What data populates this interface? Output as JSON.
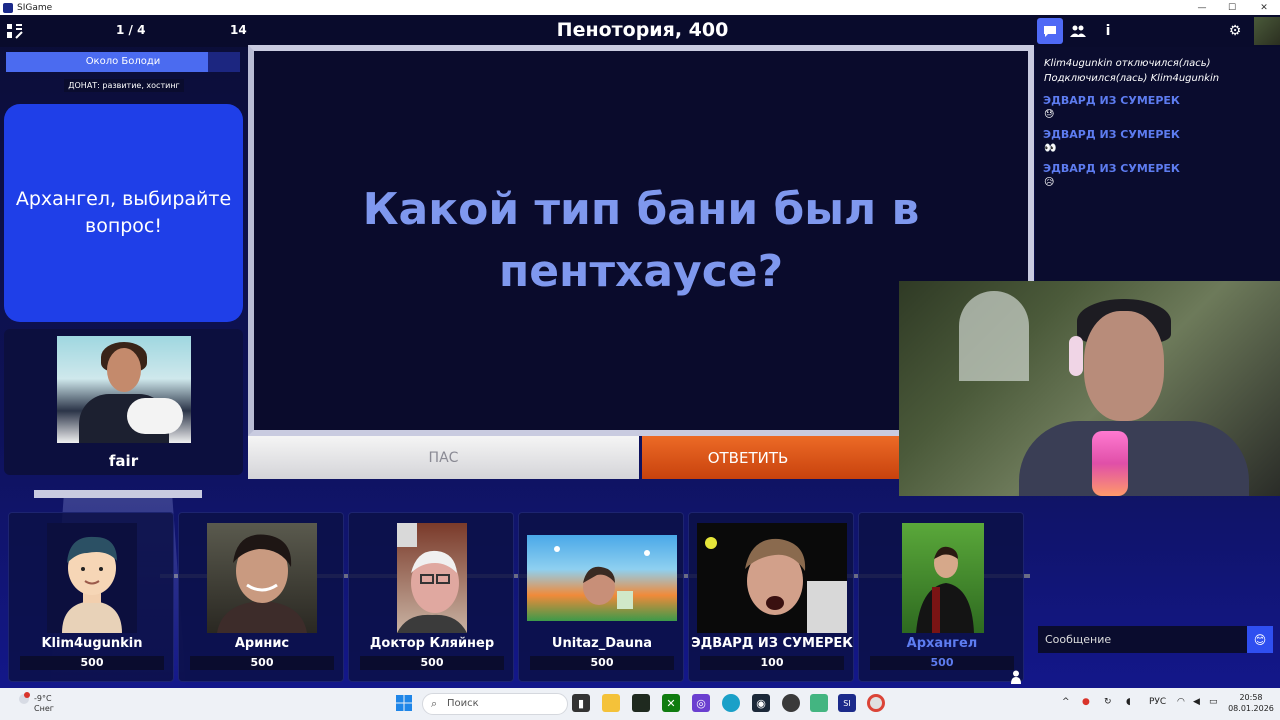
{
  "window": {
    "title": "SIGame",
    "controls": [
      "—",
      "☐",
      "✕"
    ]
  },
  "top": {
    "round": "1 / 4",
    "count": "14",
    "theme": "Пенотория, 400"
  },
  "showman": {
    "name": "Около Болоди",
    "donate": "ДОНАТ: развитие, хостинг",
    "bubble": "Архангел, выбирайте вопрос!",
    "host_name": "fair"
  },
  "question": {
    "text": "Какой тип бани был в пентхаусе?"
  },
  "buttons": {
    "pass": "ПАС",
    "answer": "ОТВЕТИТЬ"
  },
  "chat": {
    "system": [
      "Klim4ugunkin отключился(лась)",
      "Подключился(лась) Klim4ugunkin"
    ],
    "messages": [
      {
        "author": "ЭДВАРД ИЗ СУМЕРЕК",
        "text": "😓"
      },
      {
        "author": "ЭДВАРД ИЗ СУМЕРЕК",
        "text": "👀"
      },
      {
        "author": "ЭДВАРД ИЗ СУМЕРЕК",
        "text": "😥"
      }
    ],
    "input_placeholder": "Сообщение",
    "send_icon": "😊"
  },
  "players": [
    {
      "name": "Klim4ugunkin",
      "score": "500"
    },
    {
      "name": "Аринис",
      "score": "500"
    },
    {
      "name": "Доктор Кляйнер",
      "score": "500"
    },
    {
      "name": "Unitaz_Dauna",
      "score": "500"
    },
    {
      "name": "ЭДВАРД ИЗ СУМЕРЕК",
      "score": "100"
    },
    {
      "name": "Архангел",
      "score": "500"
    }
  ],
  "taskbar": {
    "weather_temp": "-9°C",
    "weather_label": "Снег",
    "weather_badge": "3",
    "search_placeholder": "Поиск",
    "lang": "РУС",
    "time": "20:58",
    "date": "08.01.2026"
  },
  "colors": {
    "accent": "#4f6af5",
    "answer_button": "#e0561a",
    "question_text": "#7f98ee",
    "active_player": "#5d7cf0"
  }
}
